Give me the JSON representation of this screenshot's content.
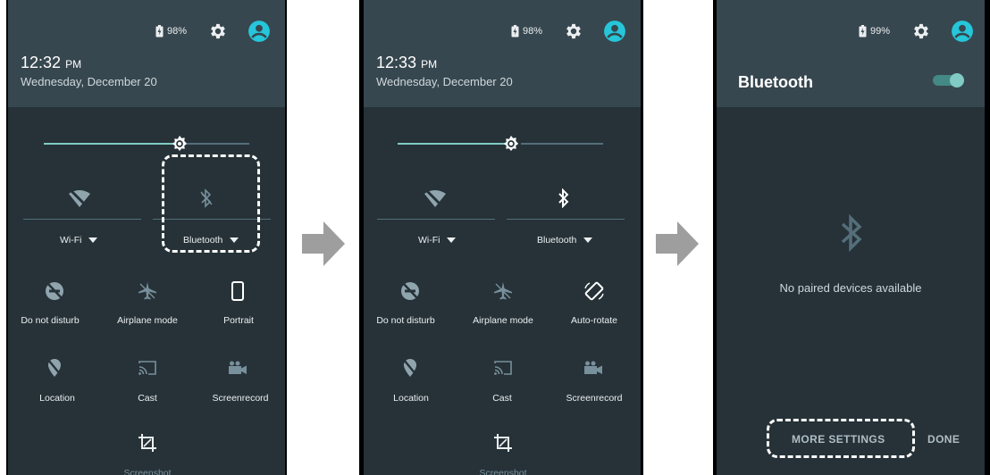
{
  "panels": [
    {
      "battery": "98%",
      "time": "12:32",
      "ampm": "PM",
      "date": "Wednesday, December 20",
      "tiles": {
        "wifi": "Wi-Fi",
        "bluetooth": "Bluetooth",
        "dnd": "Do not disturb",
        "airplane": "Airplane mode",
        "rotate": "Portrait",
        "location": "Location",
        "cast": "Cast",
        "screenrecord": "Screenrecord",
        "screenshot": "Screenshot"
      }
    },
    {
      "battery": "98%",
      "time": "12:33",
      "ampm": "PM",
      "date": "Wednesday, December 20",
      "tiles": {
        "wifi": "Wi-Fi",
        "bluetooth": "Bluetooth",
        "dnd": "Do not disturb",
        "airplane": "Airplane mode",
        "rotate": "Auto-rotate",
        "location": "Location",
        "cast": "Cast",
        "screenrecord": "Screenrecord",
        "screenshot": "Screenshot"
      }
    },
    {
      "battery": "99%",
      "title": "Bluetooth",
      "no_devices": "No paired devices available",
      "more_settings": "MORE SETTINGS",
      "done": "DONE"
    }
  ],
  "colors": {
    "accent": "#80cbc4",
    "avatar": "#26c6da",
    "panel_bg": "#263238",
    "header_bg": "#37474f"
  },
  "icons": [
    "battery-icon",
    "gear-icon",
    "account-icon",
    "brightness-icon",
    "wifi-off-icon",
    "bluetooth-off-icon",
    "bluetooth-icon",
    "dnd-icon",
    "airplane-icon",
    "portrait-icon",
    "auto-rotate-icon",
    "location-off-icon",
    "cast-icon",
    "screenrecord-icon",
    "screenshot-icon",
    "arrow-right-icon"
  ]
}
